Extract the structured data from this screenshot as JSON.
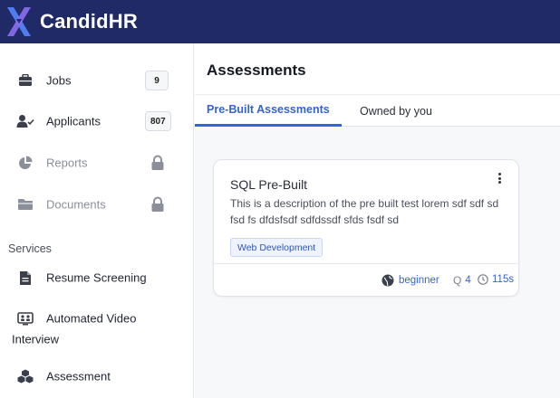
{
  "app": {
    "brand": "CandidHR"
  },
  "sidebar": {
    "items": [
      {
        "label": "Jobs",
        "badge": "9",
        "icon": "briefcase-icon"
      },
      {
        "label": "Applicants",
        "badge": "807",
        "icon": "user-check-icon"
      },
      {
        "label": "Reports",
        "icon": "pie-chart-icon",
        "locked": true
      },
      {
        "label": "Documents",
        "icon": "folder-icon",
        "locked": true
      }
    ],
    "section_title": "Services",
    "services": [
      {
        "label": "Resume Screening",
        "icon": "document-icon"
      },
      {
        "label_line1": "Automated Video",
        "label_line2": "Interview",
        "icon": "video-interview-icon"
      },
      {
        "label": "Assessment",
        "icon": "cubes-icon"
      }
    ]
  },
  "main": {
    "title": "Assessments",
    "tabs": [
      {
        "label": "Pre-Built Assessments",
        "active": true
      },
      {
        "label": "Owned by you",
        "active": false
      }
    ],
    "card": {
      "title": "SQL Pre-Built",
      "description": "This is a description of the pre built test lorem sdf sdf sd fsd fs dfdsfsdf sdfdssdf sfds fsdf sd",
      "tag": "Web Development",
      "level": "beginner",
      "questions": "4",
      "duration": "115s"
    }
  },
  "colors": {
    "topbar": "#202a66",
    "accent": "#3563d6",
    "logo_blue": "#4f7df0",
    "logo_purple": "#8b6cf0"
  }
}
